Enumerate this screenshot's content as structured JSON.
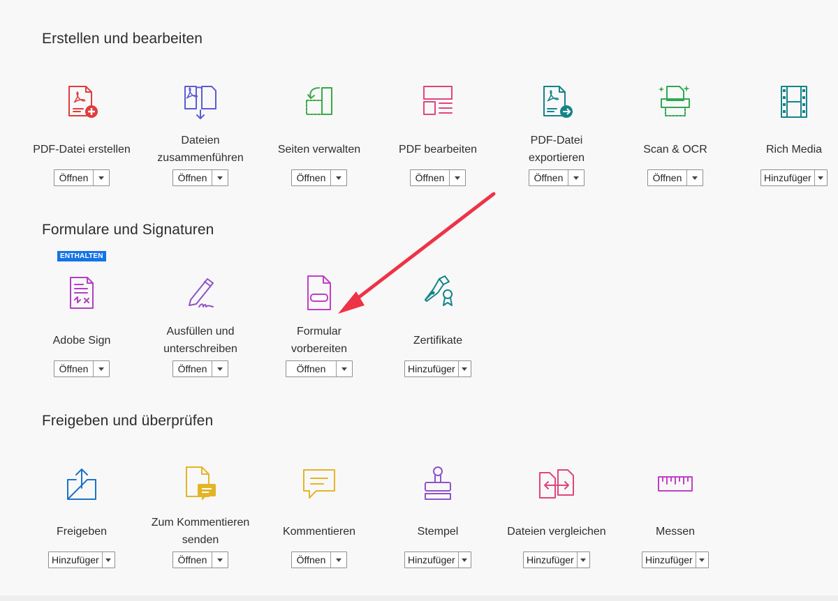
{
  "sections": [
    {
      "title": "Erstellen und bearbeiten",
      "tools": [
        {
          "label": [
            "PDF-Datei erstellen"
          ],
          "button": "Öffnen",
          "icon": "create-pdf-icon",
          "color": "#e03c3c"
        },
        {
          "label": [
            "Dateien",
            "zusammenführen"
          ],
          "button": "Öffnen",
          "icon": "combine-files-icon",
          "color": "#5b5bd6"
        },
        {
          "label": [
            "Seiten verwalten"
          ],
          "button": "Öffnen",
          "icon": "organize-pages-icon",
          "color": "#39a845"
        },
        {
          "label": [
            "PDF bearbeiten"
          ],
          "button": "Öffnen",
          "icon": "edit-pdf-icon",
          "color": "#e0457b"
        },
        {
          "label": [
            "PDF-Datei",
            "exportieren"
          ],
          "button": "Öffnen",
          "icon": "export-pdf-icon",
          "color": "#14838a"
        },
        {
          "label": [
            "Scan & OCR"
          ],
          "button": "Öffnen",
          "icon": "scan-ocr-icon",
          "color": "#2fa84f"
        },
        {
          "label": [
            "Rich Media"
          ],
          "button": "Hinzufüger",
          "icon": "rich-media-icon",
          "color": "#14838a"
        }
      ]
    },
    {
      "title": "Formulare und Signaturen",
      "tools": [
        {
          "label": [
            "Adobe Sign"
          ],
          "button": "Öffnen",
          "icon": "adobe-sign-icon",
          "color": "#b33fc4",
          "badge": "ENTHALTEN"
        },
        {
          "label": [
            "Ausfüllen und",
            "unterschreiben"
          ],
          "button": "Öffnen",
          "icon": "fill-sign-icon",
          "color": "#8e52c9"
        },
        {
          "label": [
            "Formular",
            "vorbereiten"
          ],
          "button": "Öffnen",
          "icon": "prepare-form-icon",
          "color": "#c03fc4"
        },
        {
          "label": [
            "Zertifikate"
          ],
          "button": "Hinzufüger",
          "icon": "certificates-icon",
          "color": "#14838a"
        }
      ]
    },
    {
      "title": "Freigeben und überprüfen",
      "tools": [
        {
          "label": [
            "Freigeben"
          ],
          "button": "Hinzufüger",
          "icon": "share-icon",
          "color": "#1d73c7"
        },
        {
          "label": [
            "Zum Kommentieren",
            "senden"
          ],
          "button": "Öffnen",
          "icon": "send-for-comments-icon",
          "color": "#e3b526"
        },
        {
          "label": [
            "Kommentieren"
          ],
          "button": "Öffnen",
          "icon": "comment-icon",
          "color": "#e3b526"
        },
        {
          "label": [
            "Stempel"
          ],
          "button": "Hinzufüger",
          "icon": "stamp-icon",
          "color": "#8e52c9"
        },
        {
          "label": [
            "Dateien vergleichen"
          ],
          "button": "Hinzufüger",
          "icon": "compare-files-icon",
          "color": "#e0457b"
        },
        {
          "label": [
            "Messen"
          ],
          "button": "Hinzufüger",
          "icon": "measure-icon",
          "color": "#c03fc4"
        }
      ]
    }
  ],
  "annotation": {
    "color": "#ee3346"
  }
}
